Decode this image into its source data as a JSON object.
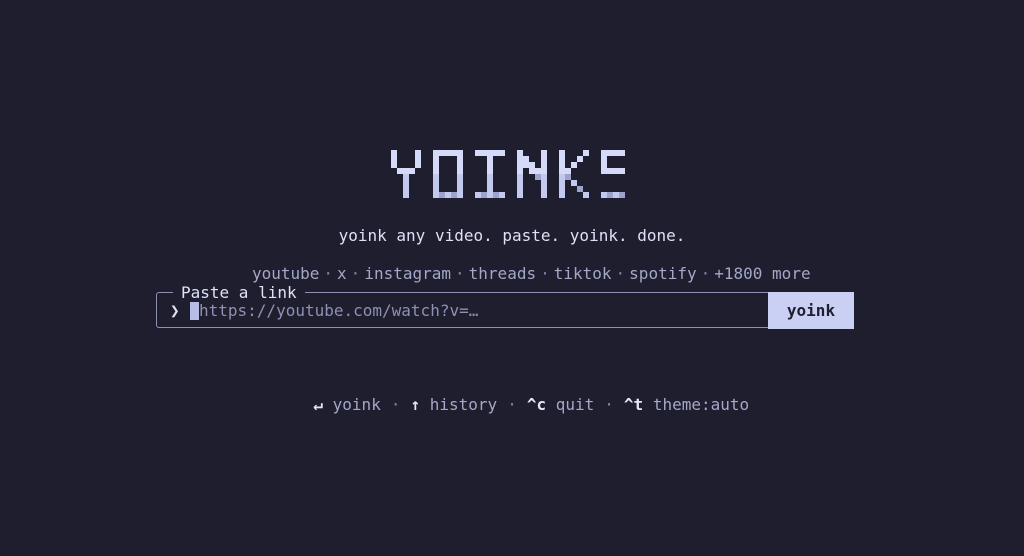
{
  "logo": {
    "text": "YOINKS"
  },
  "tagline": "yoink any video. paste. yoink. done.",
  "platforms": [
    "youtube",
    "x",
    "instagram",
    "threads",
    "tiktok",
    "spotify",
    "+1800 more"
  ],
  "platform_separator": "·",
  "input": {
    "legend": "Paste a link",
    "prompt_glyph": "❯",
    "value": "",
    "placeholder": "https://youtube.com/watch?v=…"
  },
  "submit_label": "yoink",
  "shortcuts": [
    {
      "key": "↵",
      "label": "yoink"
    },
    {
      "key": "↑",
      "label": "history"
    },
    {
      "key": "^c",
      "label": "quit"
    },
    {
      "key": "^t",
      "label": "theme:auto"
    }
  ],
  "shortcut_separator": "·",
  "colors": {
    "background": "#1f1e2e",
    "accent": "#cad0f4",
    "text": "#dde0f6",
    "muted": "#a3a7c8"
  }
}
